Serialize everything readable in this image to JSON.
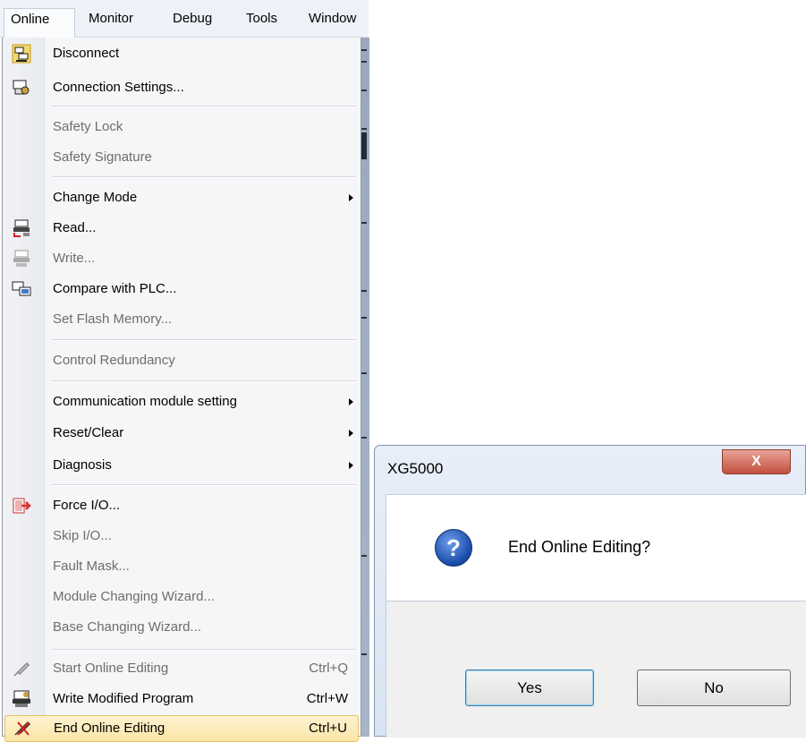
{
  "menubar": {
    "items": [
      {
        "label": "Online",
        "active": true
      },
      {
        "label": "Monitor"
      },
      {
        "label": "Debug"
      },
      {
        "label": "Tools"
      },
      {
        "label": "Window"
      }
    ]
  },
  "menu": {
    "items": [
      {
        "label": "Disconnect",
        "icon": "disconnect-icon",
        "enabled": true
      },
      {
        "label": "Connection Settings...",
        "icon": "connection-settings-icon",
        "enabled": true
      },
      {
        "label": "Safety Lock",
        "enabled": false
      },
      {
        "label": "Safety Signature",
        "enabled": false
      },
      {
        "label": "Change Mode",
        "enabled": true,
        "submenu": true
      },
      {
        "label": "Read...",
        "icon": "read-icon",
        "enabled": true
      },
      {
        "label": "Write...",
        "icon": "write-icon",
        "enabled": false
      },
      {
        "label": "Compare with PLC...",
        "icon": "compare-icon",
        "enabled": true
      },
      {
        "label": "Set Flash Memory...",
        "enabled": false
      },
      {
        "label": "Control Redundancy",
        "enabled": false
      },
      {
        "label": "Communication module setting",
        "enabled": true,
        "submenu": true
      },
      {
        "label": "Reset/Clear",
        "enabled": true,
        "submenu": true
      },
      {
        "label": "Diagnosis",
        "enabled": true,
        "submenu": true
      },
      {
        "label": "Force I/O...",
        "icon": "force-io-icon",
        "enabled": true
      },
      {
        "label": "Skip I/O...",
        "enabled": false
      },
      {
        "label": "Fault Mask...",
        "enabled": false
      },
      {
        "label": "Module Changing Wizard...",
        "enabled": false
      },
      {
        "label": "Base Changing Wizard...",
        "enabled": false
      },
      {
        "label": "Start Online Editing",
        "icon": "start-online-editing-icon",
        "enabled": false,
        "shortcut": "Ctrl+Q"
      },
      {
        "label": "Write Modified Program",
        "icon": "write-modified-program-icon",
        "enabled": true,
        "shortcut": "Ctrl+W"
      },
      {
        "label": "End Online Editing",
        "icon": "end-online-editing-icon",
        "enabled": true,
        "shortcut": "Ctrl+U",
        "highlighted": true
      }
    ]
  },
  "dialog": {
    "title": "XG5000",
    "close_label": "X",
    "message": "End Online Editing?",
    "icon": "question-icon",
    "yes_label": "Yes",
    "no_label": "No"
  },
  "colors": {
    "menu_highlight": "#fbe6a8",
    "disabled_text": "#6d6d6d",
    "close_button": "#c44f3e",
    "question_icon": "#1d4fb0"
  }
}
